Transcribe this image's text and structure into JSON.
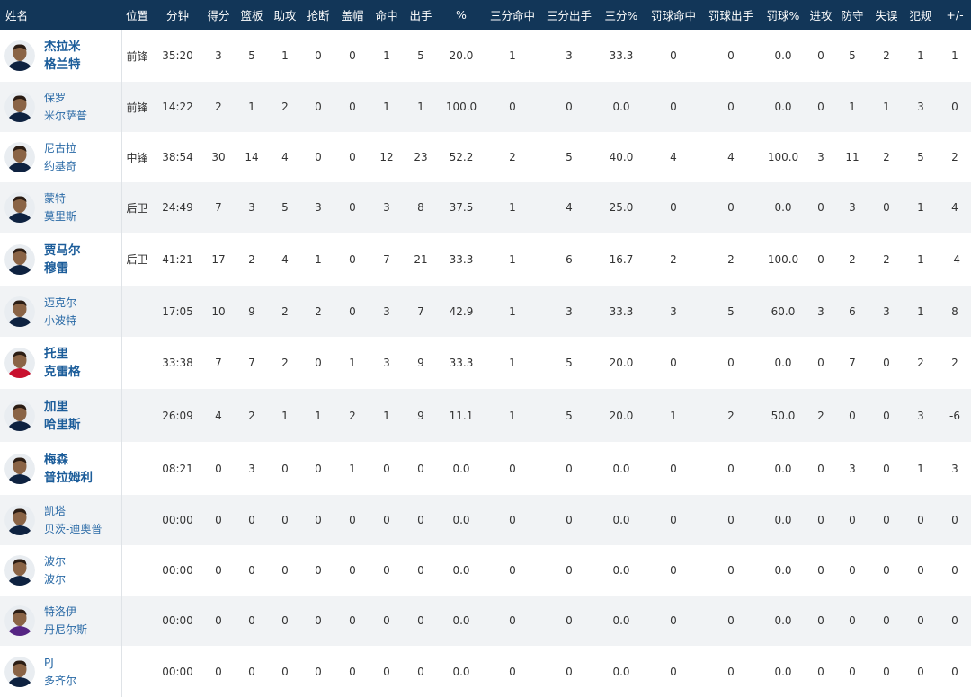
{
  "columns": [
    "姓名",
    "位置",
    "分钟",
    "得分",
    "篮板",
    "助攻",
    "抢断",
    "盖帽",
    "命中",
    "出手",
    "%",
    "三分命中",
    "三分出手",
    "三分%",
    "罚球命中",
    "罚球出手",
    "罚球%",
    "进攻",
    "防守",
    "失误",
    "犯规",
    "+/-"
  ],
  "colors": {
    "header_bg": "#123658",
    "header_text": "#ffffff",
    "row_alt_bg": "#f1f3f5",
    "name_link": "#1c5d9a"
  },
  "rows": [
    {
      "first": "杰拉米",
      "last": "格兰特",
      "bold": true,
      "jersey": "#0e2240",
      "stats": [
        "前锋",
        "35:20",
        "3",
        "5",
        "1",
        "0",
        "0",
        "1",
        "5",
        "20.0",
        "1",
        "3",
        "33.3",
        "0",
        "0",
        "0.0",
        "0",
        "5",
        "2",
        "1",
        "1"
      ]
    },
    {
      "first": "保罗",
      "last": "米尔萨普",
      "bold": false,
      "jersey": "#0e2240",
      "stats": [
        "前锋",
        "14:22",
        "2",
        "1",
        "2",
        "0",
        "0",
        "1",
        "1",
        "100.0",
        "0",
        "0",
        "0.0",
        "0",
        "0",
        "0.0",
        "0",
        "1",
        "1",
        "3",
        "0"
      ]
    },
    {
      "first": "尼古拉",
      "last": "约基奇",
      "bold": false,
      "jersey": "#0e2240",
      "stats": [
        "中锋",
        "38:54",
        "30",
        "14",
        "4",
        "0",
        "0",
        "12",
        "23",
        "52.2",
        "2",
        "5",
        "40.0",
        "4",
        "4",
        "100.0",
        "3",
        "11",
        "2",
        "5",
        "2"
      ]
    },
    {
      "first": "蒙特",
      "last": "莫里斯",
      "bold": false,
      "jersey": "#0e2240",
      "stats": [
        "后卫",
        "24:49",
        "7",
        "3",
        "5",
        "3",
        "0",
        "3",
        "8",
        "37.5",
        "1",
        "4",
        "25.0",
        "0",
        "0",
        "0.0",
        "0",
        "3",
        "0",
        "1",
        "4"
      ]
    },
    {
      "first": "贾马尔",
      "last": "穆雷",
      "bold": true,
      "jersey": "#0e2240",
      "stats": [
        "后卫",
        "41:21",
        "17",
        "2",
        "4",
        "1",
        "0",
        "7",
        "21",
        "33.3",
        "1",
        "6",
        "16.7",
        "2",
        "2",
        "100.0",
        "0",
        "2",
        "2",
        "1",
        "-4"
      ]
    },
    {
      "first": "迈克尔",
      "last": "小波特",
      "bold": false,
      "jersey": "#0e2240",
      "stats": [
        "",
        "17:05",
        "10",
        "9",
        "2",
        "2",
        "0",
        "3",
        "7",
        "42.9",
        "1",
        "3",
        "33.3",
        "3",
        "5",
        "60.0",
        "3",
        "6",
        "3",
        "1",
        "8"
      ]
    },
    {
      "first": "托里",
      "last": "克雷格",
      "bold": true,
      "jersey": "#c8102e",
      "stats": [
        "",
        "33:38",
        "7",
        "7",
        "2",
        "0",
        "1",
        "3",
        "9",
        "33.3",
        "1",
        "5",
        "20.0",
        "0",
        "0",
        "0.0",
        "0",
        "7",
        "0",
        "2",
        "2"
      ]
    },
    {
      "first": "加里",
      "last": "哈里斯",
      "bold": true,
      "jersey": "#0e2240",
      "stats": [
        "",
        "26:09",
        "4",
        "2",
        "1",
        "1",
        "2",
        "1",
        "9",
        "11.1",
        "1",
        "5",
        "20.0",
        "1",
        "2",
        "50.0",
        "2",
        "0",
        "0",
        "3",
        "-6"
      ]
    },
    {
      "first": "梅森",
      "last": "普拉姆利",
      "bold": true,
      "jersey": "#0e2240",
      "stats": [
        "",
        "08:21",
        "0",
        "3",
        "0",
        "0",
        "1",
        "0",
        "0",
        "0.0",
        "0",
        "0",
        "0.0",
        "0",
        "0",
        "0.0",
        "0",
        "3",
        "0",
        "1",
        "3"
      ]
    },
    {
      "first": "凯塔",
      "last": "贝茨-迪奥普",
      "bold": false,
      "jersey": "#0e2240",
      "stats": [
        "",
        "00:00",
        "0",
        "0",
        "0",
        "0",
        "0",
        "0",
        "0",
        "0.0",
        "0",
        "0",
        "0.0",
        "0",
        "0",
        "0.0",
        "0",
        "0",
        "0",
        "0",
        "0"
      ]
    },
    {
      "first": "波尔",
      "last": "波尔",
      "bold": false,
      "jersey": "#0e2240",
      "stats": [
        "",
        "00:00",
        "0",
        "0",
        "0",
        "0",
        "0",
        "0",
        "0",
        "0.0",
        "0",
        "0",
        "0.0",
        "0",
        "0",
        "0.0",
        "0",
        "0",
        "0",
        "0",
        "0"
      ]
    },
    {
      "first": "特洛伊",
      "last": "丹尼尔斯",
      "bold": false,
      "jersey": "#552583",
      "stats": [
        "",
        "00:00",
        "0",
        "0",
        "0",
        "0",
        "0",
        "0",
        "0",
        "0.0",
        "0",
        "0",
        "0.0",
        "0",
        "0",
        "0.0",
        "0",
        "0",
        "0",
        "0",
        "0"
      ]
    },
    {
      "first": "PJ",
      "last": "多齐尔",
      "bold": false,
      "jersey": "#0e2240",
      "stats": [
        "",
        "00:00",
        "0",
        "0",
        "0",
        "0",
        "0",
        "0",
        "0",
        "0.0",
        "0",
        "0",
        "0.0",
        "0",
        "0",
        "0.0",
        "0",
        "0",
        "0",
        "0",
        "0"
      ]
    }
  ]
}
